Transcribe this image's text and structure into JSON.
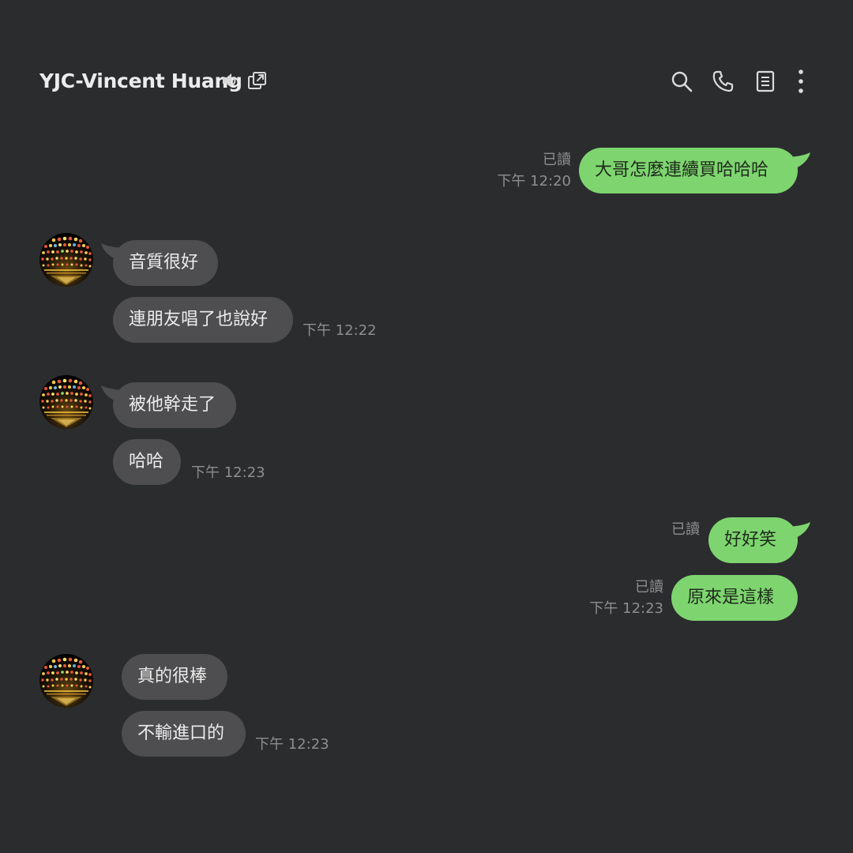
{
  "header": {
    "title": "YJC-Vincent Huang",
    "icons": [
      "speaker-icon",
      "external-window-icon",
      "search-icon",
      "phone-icon",
      "notes-icon",
      "more-vertical-icon"
    ]
  },
  "colors": {
    "background": "#2b2c2e",
    "incoming_bubble": "#4e4e50",
    "outgoing_bubble": "#7ed56f",
    "meta_text": "#8e8e8e"
  },
  "messages": [
    {
      "direction": "out",
      "text": "大哥怎麼連續買哈哈哈",
      "read": "已讀",
      "time": "下午 12:20"
    },
    {
      "direction": "in",
      "text": "音質很好"
    },
    {
      "direction": "in",
      "text": "連朋友唱了也說好",
      "time": "下午 12:22"
    },
    {
      "direction": "in",
      "text": "被他幹走了"
    },
    {
      "direction": "in",
      "text": "哈哈",
      "time": "下午 12:23"
    },
    {
      "direction": "out",
      "text": "好好笑",
      "read": "已讀"
    },
    {
      "direction": "out",
      "text": "原來是這樣",
      "read": "已讀",
      "time": "下午 12:23"
    },
    {
      "direction": "in",
      "text": "真的很棒"
    },
    {
      "direction": "in",
      "text": "不輸進口的",
      "time": "下午 12:23"
    }
  ]
}
